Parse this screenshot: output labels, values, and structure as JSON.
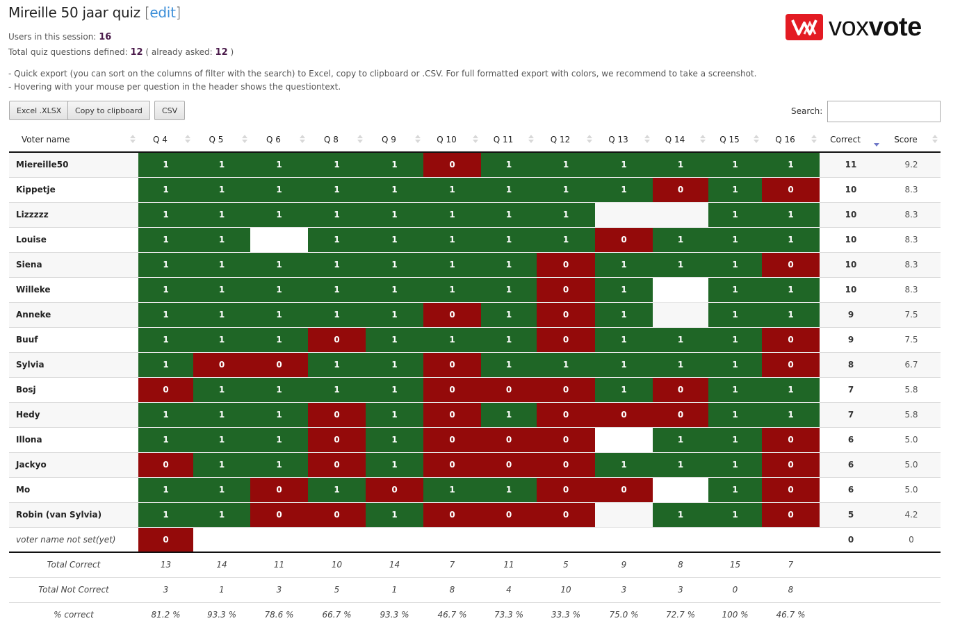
{
  "header": {
    "title": "Mireille 50 jaar quiz",
    "edit_label": "edit",
    "users_label": "Users in this session:",
    "users_count": "16",
    "questions_label": "Total quiz questions defined:",
    "questions_count": "12",
    "asked_label": "already asked:",
    "asked_count": "12",
    "note1": "- Quick export (you can sort on the columns of filter with the search) to Excel, copy to clipboard or .CSV. For full formatted export with colors, we recommend to take a screenshot.",
    "note2": "- Hovering with your mouse per question in the header shows the questiontext."
  },
  "logo": {
    "light": "vox",
    "bold": "vote",
    "brand_color": "#e31b23"
  },
  "toolbar": {
    "excel_label": "Excel .XLSX",
    "clipboard_label": "Copy to clipboard",
    "csv_label": "CSV",
    "search_label": "Search:",
    "search_value": ""
  },
  "colors": {
    "correct": "#1f6626",
    "wrong": "#940a0a"
  },
  "table": {
    "columns": [
      "Voter name",
      "Q 4",
      "Q 5",
      "Q 6",
      "Q 8",
      "Q 9",
      "Q 10",
      "Q 11",
      "Q 12",
      "Q 13",
      "Q 14",
      "Q 15",
      "Q 16",
      "Correct",
      "Score"
    ],
    "sorted_column": "Correct",
    "rows": [
      {
        "name": "Miereille50",
        "answers": [
          "1",
          "1",
          "1",
          "1",
          "1",
          "0",
          "1",
          "1",
          "1",
          "1",
          "1",
          "1"
        ],
        "correct": "11",
        "score": "9.2"
      },
      {
        "name": "Kippetje",
        "answers": [
          "1",
          "1",
          "1",
          "1",
          "1",
          "1",
          "1",
          "1",
          "1",
          "0",
          "1",
          "0"
        ],
        "correct": "10",
        "score": "8.3"
      },
      {
        "name": "Lizzzzz",
        "answers": [
          "1",
          "1",
          "1",
          "1",
          "1",
          "1",
          "1",
          "1",
          "",
          "",
          "1",
          "1"
        ],
        "correct": "10",
        "score": "8.3"
      },
      {
        "name": "Louise",
        "answers": [
          "1",
          "1",
          "",
          "1",
          "1",
          "1",
          "1",
          "1",
          "0",
          "1",
          "1",
          "1"
        ],
        "correct": "10",
        "score": "8.3"
      },
      {
        "name": "Siena",
        "answers": [
          "1",
          "1",
          "1",
          "1",
          "1",
          "1",
          "1",
          "0",
          "1",
          "1",
          "1",
          "0"
        ],
        "correct": "10",
        "score": "8.3"
      },
      {
        "name": "Willeke",
        "answers": [
          "1",
          "1",
          "1",
          "1",
          "1",
          "1",
          "1",
          "0",
          "1",
          "",
          "1",
          "1"
        ],
        "correct": "10",
        "score": "8.3"
      },
      {
        "name": "Anneke",
        "answers": [
          "1",
          "1",
          "1",
          "1",
          "1",
          "0",
          "1",
          "0",
          "1",
          "",
          "1",
          "1"
        ],
        "correct": "9",
        "score": "7.5"
      },
      {
        "name": "Buuf",
        "answers": [
          "1",
          "1",
          "1",
          "0",
          "1",
          "1",
          "1",
          "0",
          "1",
          "1",
          "1",
          "0"
        ],
        "correct": "9",
        "score": "7.5"
      },
      {
        "name": "Sylvia",
        "answers": [
          "1",
          "0",
          "0",
          "1",
          "1",
          "0",
          "1",
          "1",
          "1",
          "1",
          "1",
          "0"
        ],
        "correct": "8",
        "score": "6.7"
      },
      {
        "name": "Bosj",
        "answers": [
          "0",
          "1",
          "1",
          "1",
          "1",
          "0",
          "0",
          "0",
          "1",
          "0",
          "1",
          "1"
        ],
        "correct": "7",
        "score": "5.8"
      },
      {
        "name": "Hedy",
        "answers": [
          "1",
          "1",
          "1",
          "0",
          "1",
          "0",
          "1",
          "0",
          "0",
          "0",
          "1",
          "1"
        ],
        "correct": "7",
        "score": "5.8"
      },
      {
        "name": "Illona",
        "answers": [
          "1",
          "1",
          "1",
          "0",
          "1",
          "0",
          "0",
          "0",
          "",
          "1",
          "1",
          "0"
        ],
        "correct": "6",
        "score": "5.0"
      },
      {
        "name": "Jackyo",
        "answers": [
          "0",
          "1",
          "1",
          "0",
          "1",
          "0",
          "0",
          "0",
          "1",
          "1",
          "1",
          "0"
        ],
        "correct": "6",
        "score": "5.0"
      },
      {
        "name": "Mo",
        "answers": [
          "1",
          "1",
          "0",
          "1",
          "0",
          "1",
          "1",
          "0",
          "0",
          "",
          "1",
          "0"
        ],
        "correct": "6",
        "score": "5.0"
      },
      {
        "name": "Robin (van Sylvia)",
        "answers": [
          "1",
          "1",
          "0",
          "0",
          "1",
          "0",
          "0",
          "0",
          "",
          "1",
          "1",
          "0"
        ],
        "correct": "5",
        "score": "4.2"
      },
      {
        "name": "voter name not set(yet)",
        "unset": true,
        "answers": [
          "0",
          "",
          "",
          "",
          "",
          "",
          "",
          "",
          "",
          "",
          "",
          ""
        ],
        "correct": "0",
        "score": "0"
      }
    ],
    "footer": [
      {
        "label": "Total Correct",
        "values": [
          "13",
          "14",
          "11",
          "10",
          "14",
          "7",
          "11",
          "5",
          "9",
          "8",
          "15",
          "7"
        ]
      },
      {
        "label": "Total Not Correct",
        "values": [
          "3",
          "1",
          "3",
          "5",
          "1",
          "8",
          "4",
          "10",
          "3",
          "3",
          "0",
          "8"
        ]
      },
      {
        "label": "% correct",
        "values": [
          "81.2 %",
          "93.3 %",
          "78.6 %",
          "66.7 %",
          "93.3 %",
          "46.7 %",
          "73.3 %",
          "33.3 %",
          "75.0 %",
          "72.7 %",
          "100 %",
          "46.7 %"
        ]
      }
    ]
  }
}
